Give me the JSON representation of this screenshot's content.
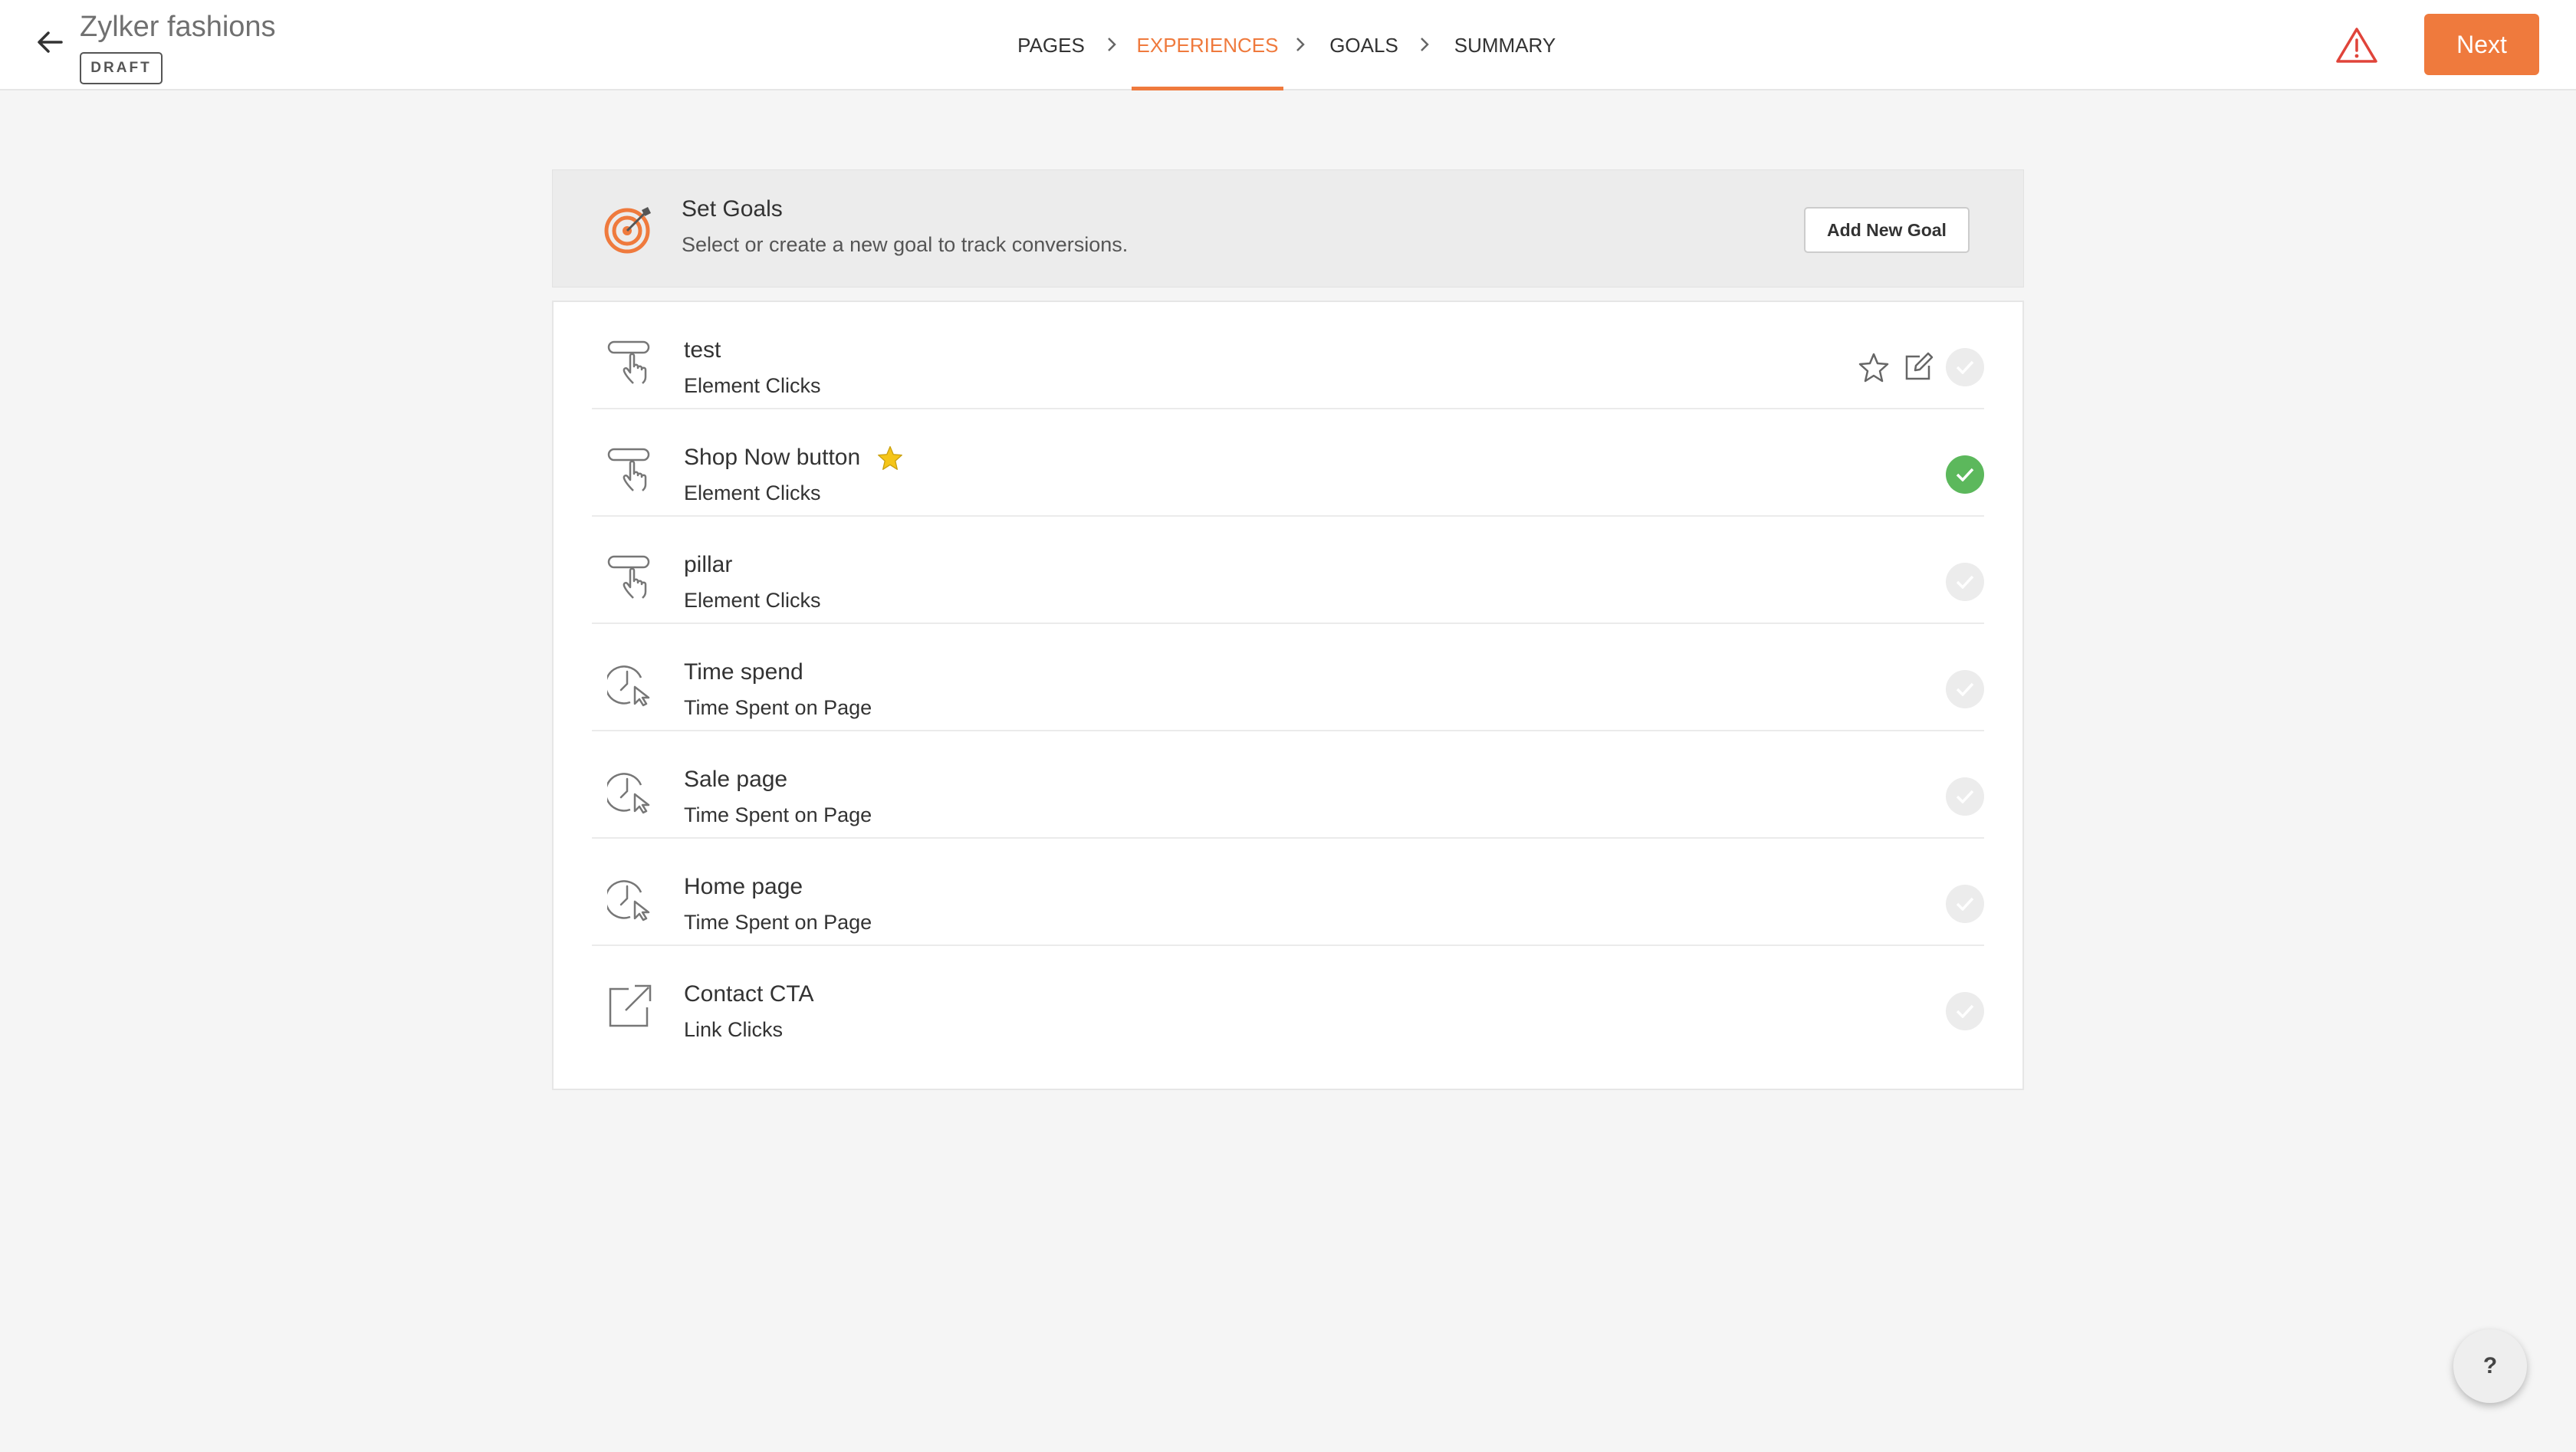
{
  "header": {
    "title": "Zylker fashions",
    "status_badge": "DRAFT",
    "next_label": "Next"
  },
  "steps": [
    {
      "label": "PAGES",
      "active": false
    },
    {
      "label": "EXPERIENCES",
      "active": true
    },
    {
      "label": "GOALS",
      "active": false
    },
    {
      "label": "SUMMARY",
      "active": false
    }
  ],
  "goals_panel": {
    "title": "Set Goals",
    "subtitle": "Select or create a new goal to track conversions.",
    "add_button_label": "Add New Goal"
  },
  "goals": [
    {
      "name": "test",
      "type": "Element Clicks",
      "icon": "element-click-icon",
      "primary": false,
      "selected": false,
      "hovered": true
    },
    {
      "name": "Shop Now button",
      "type": "Element Clicks",
      "icon": "element-click-icon",
      "primary": true,
      "selected": true,
      "hovered": false
    },
    {
      "name": "pillar",
      "type": "Element Clicks",
      "icon": "element-click-icon",
      "primary": false,
      "selected": false,
      "hovered": false
    },
    {
      "name": "Time spend",
      "type": "Time Spent on Page",
      "icon": "time-spent-icon",
      "primary": false,
      "selected": false,
      "hovered": false
    },
    {
      "name": "Sale page",
      "type": "Time Spent on Page",
      "icon": "time-spent-icon",
      "primary": false,
      "selected": false,
      "hovered": false
    },
    {
      "name": "Home page",
      "type": "Time Spent on Page",
      "icon": "time-spent-icon",
      "primary": false,
      "selected": false,
      "hovered": false
    },
    {
      "name": "Contact CTA",
      "type": "Link Clicks",
      "icon": "link-click-icon",
      "primary": false,
      "selected": false,
      "hovered": false
    }
  ],
  "help_label": "?",
  "colors": {
    "accent": "#ef7a3d",
    "success": "#5cb85c",
    "warning": "#e0443a",
    "star": "#f5c518"
  }
}
